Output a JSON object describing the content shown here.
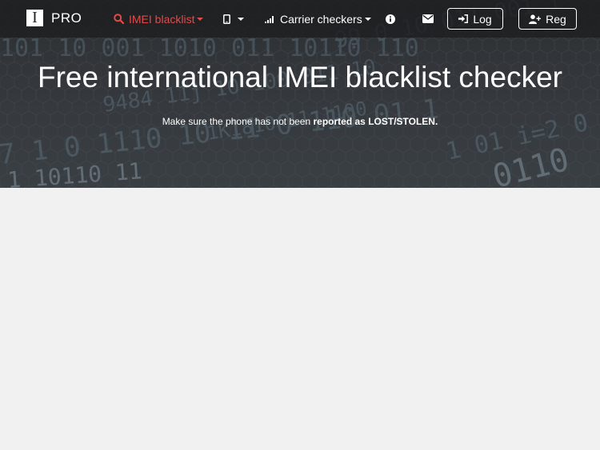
{
  "brand": {
    "logo_letter": "I",
    "name": "PRO"
  },
  "nav": {
    "imei_blacklist": "IMEI blacklist",
    "carrier_checkers": "Carrier checkers",
    "log_button": "Log",
    "reg_button": "Reg"
  },
  "hero": {
    "title": "Free international IMEI blacklist checker",
    "subtitle_prefix": "Make sure the phone has not been",
    "subtitle_bold": "reported as LOST/STOLEN."
  },
  "colors": {
    "active_nav": "#e14b4b",
    "navbar_bg": "#1c1d1f",
    "page_bg": "#f1f1f1"
  },
  "icons": {
    "search": "search-icon",
    "phone": "phone-icon",
    "signal": "signal-icon",
    "info": "info-icon",
    "mail": "envelope-icon",
    "login": "sign-in-icon",
    "register": "user-plus-icon"
  }
}
